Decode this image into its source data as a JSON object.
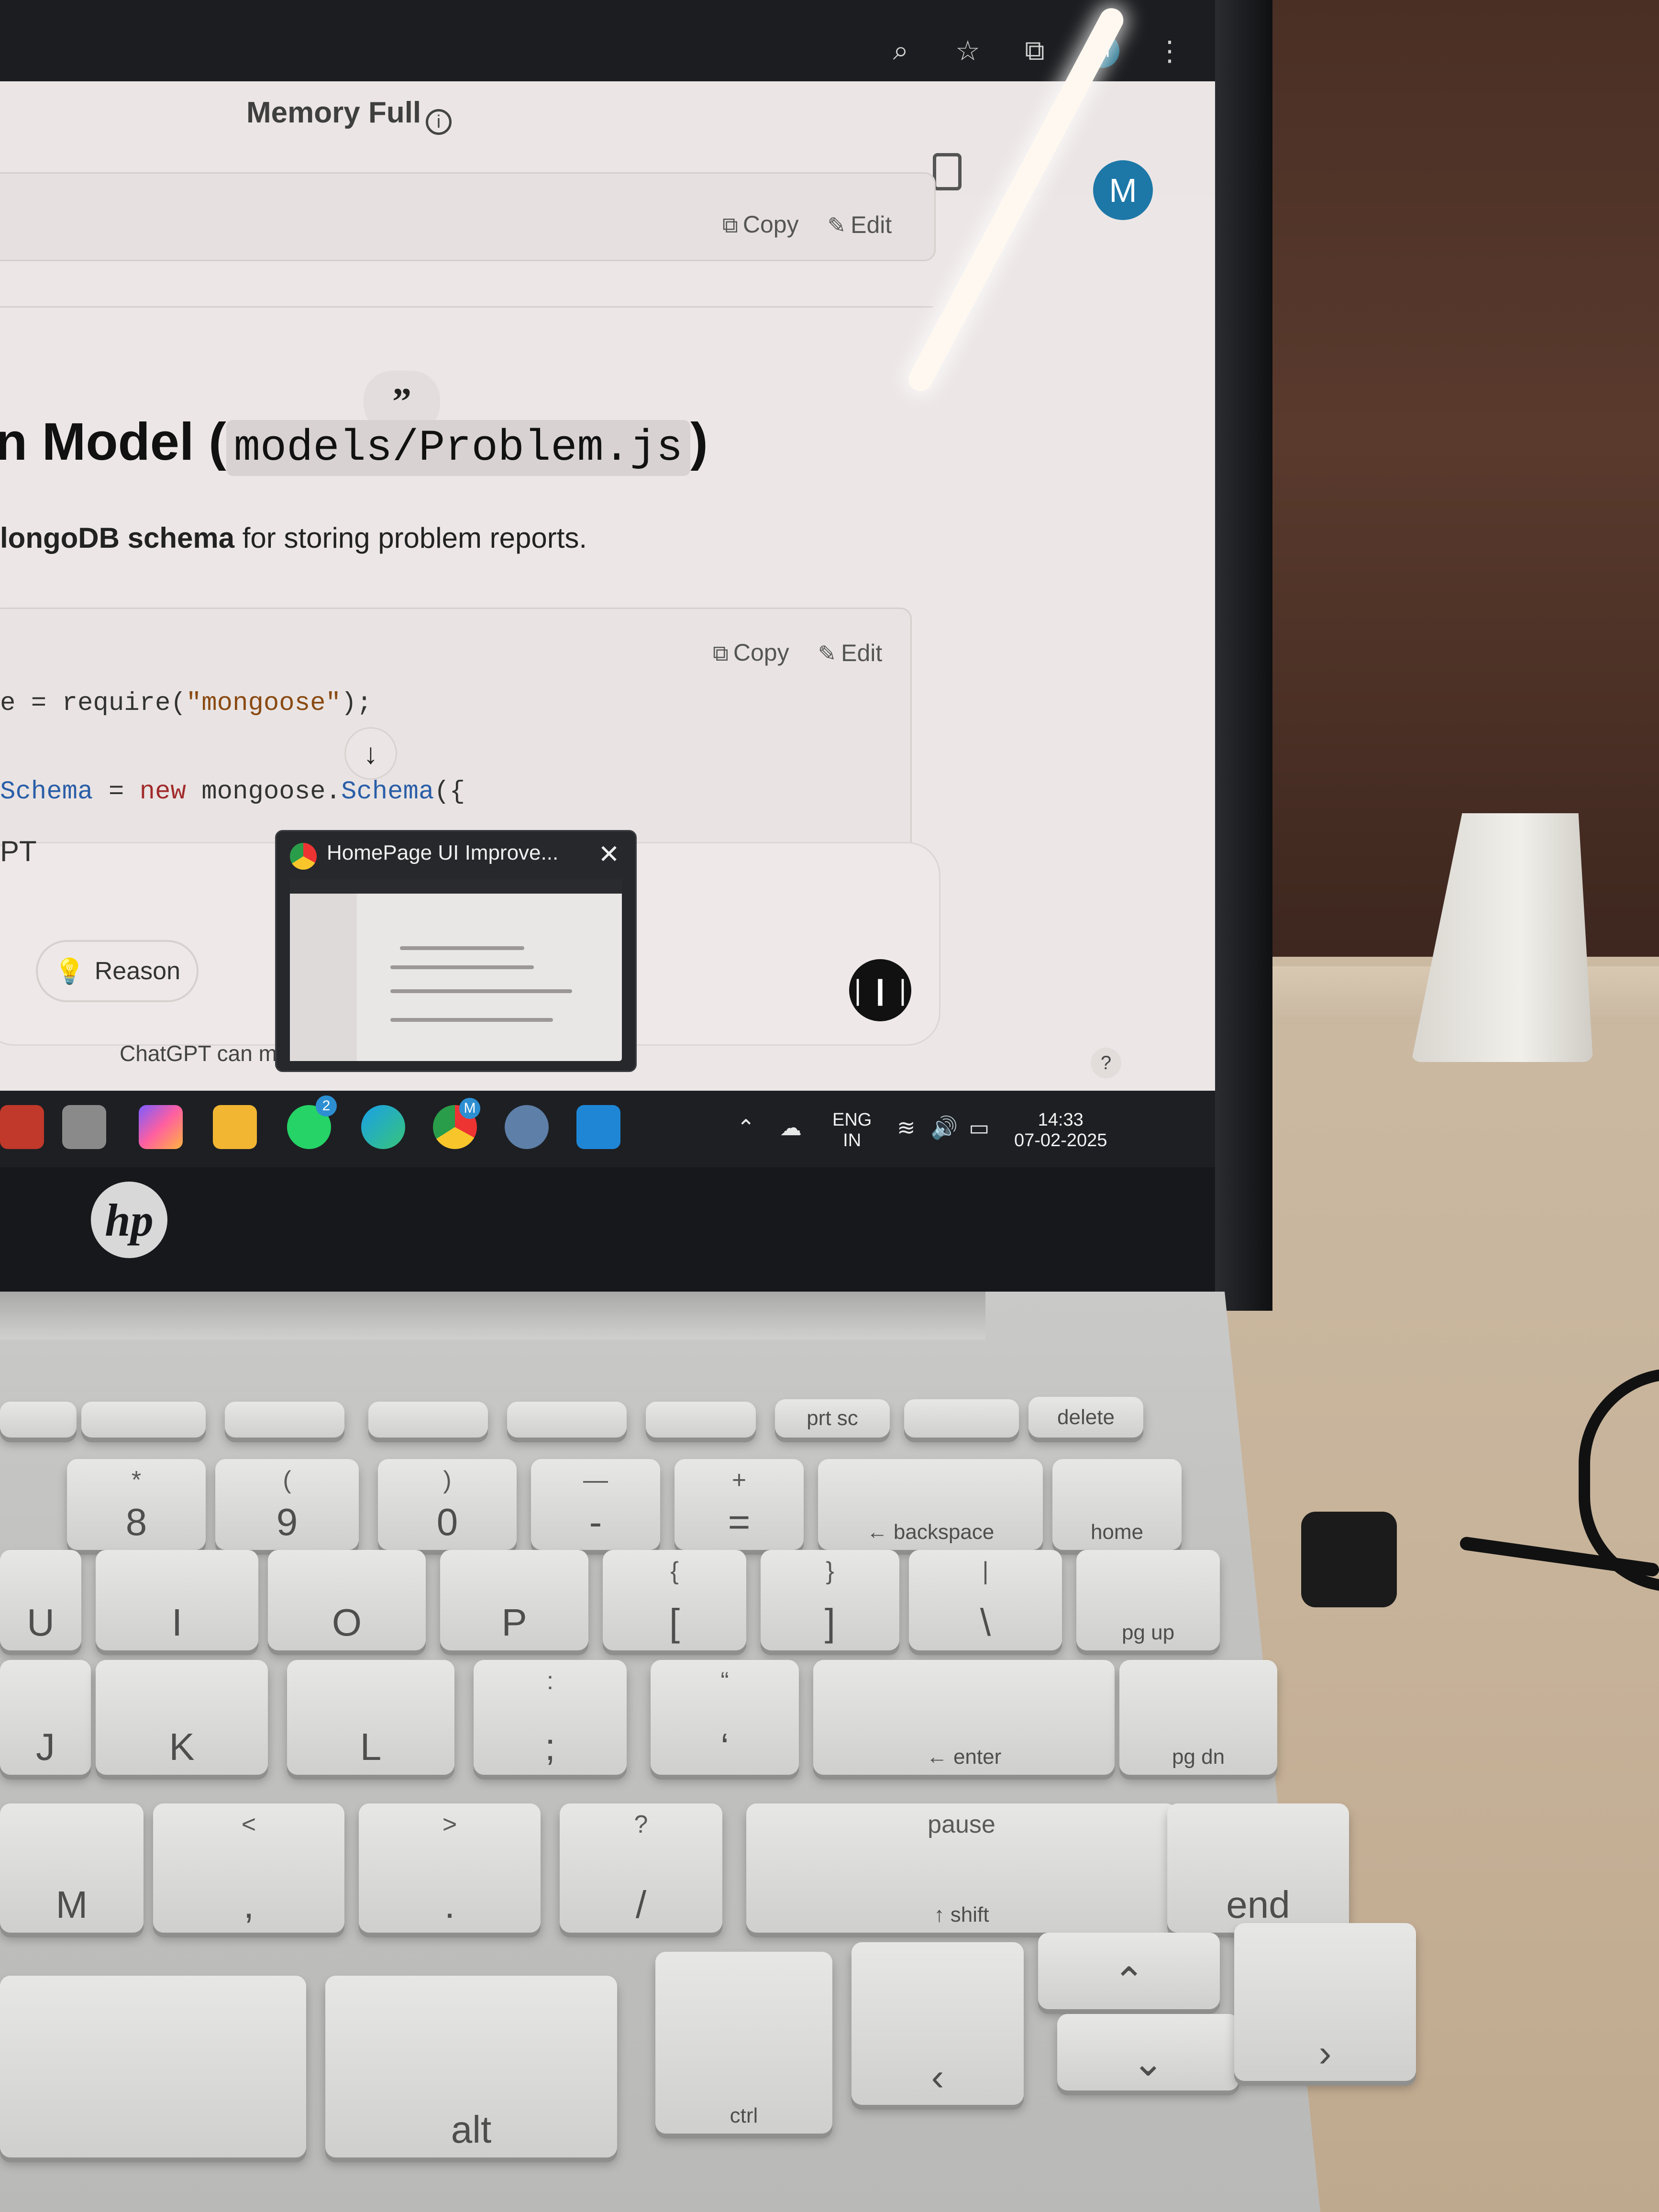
{
  "browser": {
    "profile_initial": "M"
  },
  "chat_header": {
    "memory_status": "Memory Full",
    "info_icon": "info-icon",
    "avatar_initial": "M"
  },
  "code_block_top": {
    "copy_label": "Copy",
    "edit_label": "Edit"
  },
  "section": {
    "heading_prefix": "n Model (",
    "heading_code": "models/Problem.js",
    "heading_suffix": ")",
    "subtext_bold": "longoDB schema",
    "subtext_rest": " for storing problem reports."
  },
  "code_block": {
    "copy_label": "Copy",
    "edit_label": "Edit",
    "line1_prefix": "e = require(",
    "line1_string": "\"mongoose\"",
    "line1_suffix": ");",
    "line2_prefix": "Schema",
    "line2_eq": " = ",
    "line2_new": "new",
    "line2_obj": " mongoose.",
    "line2_type": "Schema",
    "line2_suffix": "({"
  },
  "composer": {
    "text_fragment": "PT",
    "reason_label": "Reason",
    "disclaimer": "ChatGPT can ma"
  },
  "preview": {
    "title": "HomePage UI Improve...",
    "close_icon": "close-icon"
  },
  "taskbar": {
    "whatsapp_badge": "2",
    "chrome_badge": "M",
    "language_top": "ENG",
    "language_bottom": "IN",
    "time": "14:33",
    "date": "07-02-2025"
  },
  "keyboard": {
    "row_f": [
      "prt sc",
      "delete"
    ],
    "row_num": [
      {
        "top": "*",
        "main": "8"
      },
      {
        "top": "(",
        "main": "9"
      },
      {
        "top": ")",
        "main": "0"
      },
      {
        "top": "—",
        "main": "-"
      },
      {
        "top": "+",
        "main": "="
      },
      {
        "top": "",
        "main": "← backspace"
      },
      {
        "top": "",
        "main": "home"
      }
    ],
    "row_top": [
      {
        "top": "",
        "main": "U"
      },
      {
        "top": "",
        "main": "I"
      },
      {
        "top": "",
        "main": "O"
      },
      {
        "top": "",
        "main": "P"
      },
      {
        "top": "{",
        "main": "["
      },
      {
        "top": "}",
        "main": "]"
      },
      {
        "top": "|",
        "main": "\\"
      },
      {
        "top": "",
        "main": "pg up"
      }
    ],
    "row_home": [
      {
        "top": "",
        "main": "J"
      },
      {
        "top": "",
        "main": "K"
      },
      {
        "top": "",
        "main": "L"
      },
      {
        "top": ":",
        "main": ";"
      },
      {
        "top": "“",
        "main": "‘"
      },
      {
        "top": "",
        "main": "← enter"
      },
      {
        "top": "",
        "main": "pg dn"
      }
    ],
    "row_bottom": [
      {
        "top": "",
        "main": "M"
      },
      {
        "top": "<",
        "main": ","
      },
      {
        "top": ">",
        "main": "."
      },
      {
        "top": "?",
        "main": "/"
      },
      {
        "top": "pause",
        "main": "↑ shift"
      },
      {
        "top": "",
        "main": "end"
      }
    ],
    "row_space": [
      {
        "top": "",
        "main": "alt"
      },
      {
        "top": "",
        "main": "ctrl"
      }
    ]
  }
}
